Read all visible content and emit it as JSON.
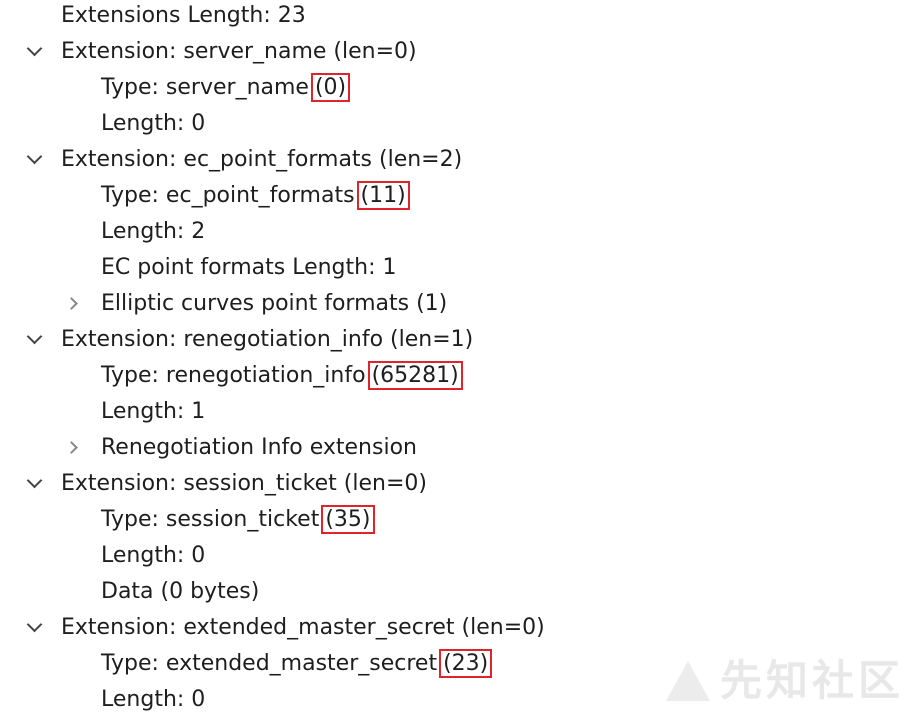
{
  "tree": {
    "ext_length": "Extensions Length: 23",
    "extensions": [
      {
        "header": "Extension: server_name (len=0)",
        "type_prefix": "Type: server_name",
        "type_code": "(0)",
        "length": "Length: 0"
      },
      {
        "header": "Extension: ec_point_formats (len=2)",
        "type_prefix": "Type: ec_point_formats",
        "type_code": "(11)",
        "length": "Length: 2",
        "extra": "EC point formats Length: 1",
        "child": "Elliptic curves point formats (1)"
      },
      {
        "header": "Extension: renegotiation_info (len=1)",
        "type_prefix": "Type: renegotiation_info",
        "type_code": "(65281)",
        "length": "Length: 1",
        "child": "Renegotiation Info extension"
      },
      {
        "header": "Extension: session_ticket (len=0)",
        "type_prefix": "Type: session_ticket",
        "type_code": "(35)",
        "length": "Length: 0",
        "extra": "Data (0 bytes)"
      },
      {
        "header": "Extension: extended_master_secret (len=0)",
        "type_prefix": "Type: extended_master_secret",
        "type_code": "(23)",
        "length": "Length: 0"
      }
    ]
  },
  "watermark": {
    "text": "先知社区"
  },
  "colors": {
    "highlight_border": "#e0242b",
    "text": "#1e1e1e",
    "background": "#ffffff"
  },
  "icons": {
    "expanded": "chevron-down-icon",
    "collapsed": "chevron-right-icon"
  }
}
